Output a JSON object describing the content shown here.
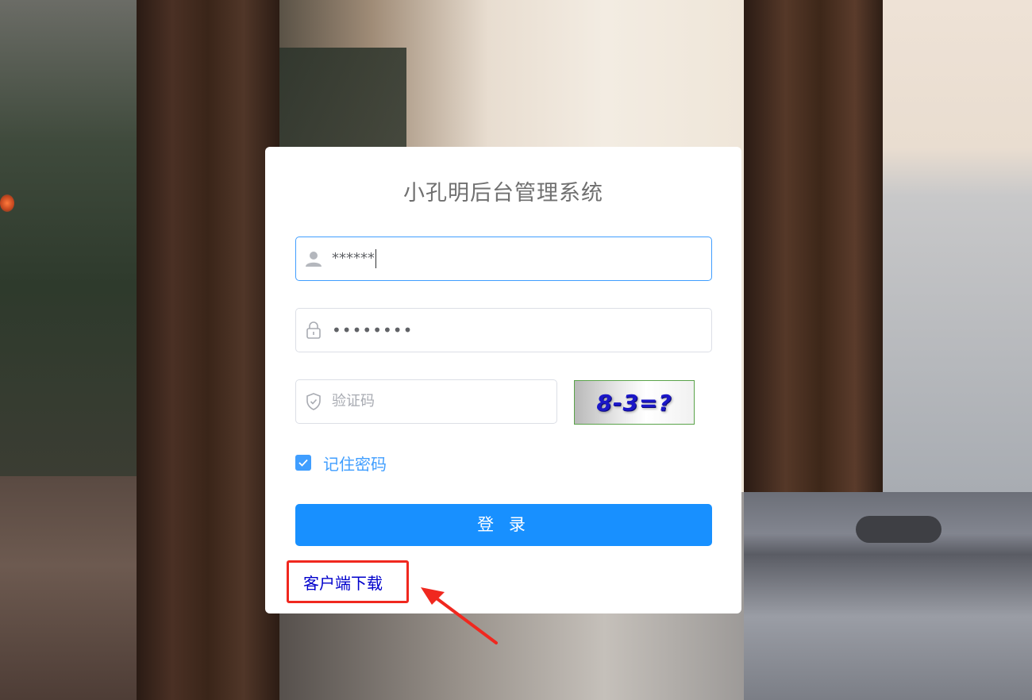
{
  "login": {
    "title": "小孔明后台管理系统",
    "username": {
      "value": "******",
      "icon": "user-icon"
    },
    "password": {
      "value": "••••••••",
      "icon": "lock-icon"
    },
    "captcha": {
      "placeholder": "验证码",
      "icon": "shield-check-icon",
      "image_text": "8-3=?"
    },
    "remember": {
      "label": "记住密码",
      "checked": true
    },
    "submit_label": "登 录",
    "download_label": "客户端下载"
  },
  "colors": {
    "primary": "#1890ff",
    "accent_blue": "#409eff",
    "highlight_red": "#f0281f",
    "link": "#0000cc"
  }
}
